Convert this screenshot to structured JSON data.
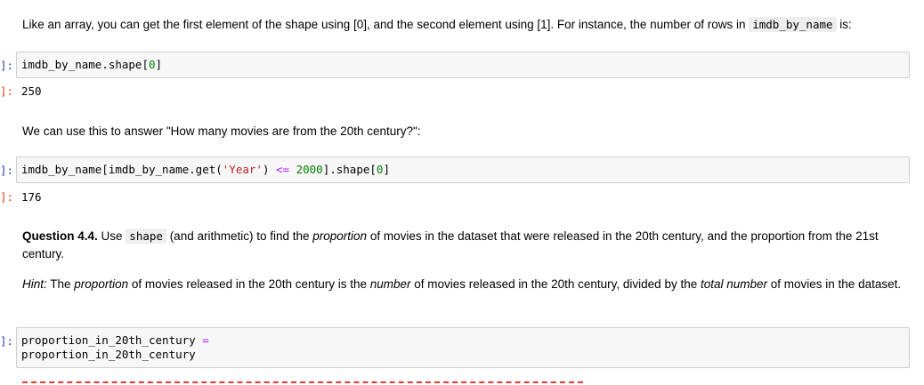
{
  "intro": {
    "text_a": "Like an array, you can get the first element of the shape using [0], and the second element using [1]. For instance, the number of rows in ",
    "code": "imdb_by_name",
    "text_b": " is:"
  },
  "cell1": {
    "prompt": "]:",
    "code_a": "imdb_by_name.shape[",
    "num": "0",
    "code_b": "]",
    "out_prompt": "]:",
    "output": "250"
  },
  "para2": "We can use this to answer \"How many movies are from the 20th century?\":",
  "cell2": {
    "prompt": "]:",
    "code_a": "imdb_by_name[imdb_by_name.get(",
    "str": "'Year'",
    "code_b": ") ",
    "op": "<=",
    "code_c": " ",
    "num1": "2000",
    "code_d": "].shape[",
    "num2": "0",
    "code_e": "]",
    "out_prompt": "]:",
    "output": "176"
  },
  "question": {
    "label": "Question 4.4.",
    "t1": " Use ",
    "code": "shape",
    "t2": " (and arithmetic) to find the ",
    "em1": "proportion",
    "t3": " of movies in the dataset that were released in the 20th century, and the proportion from the 21st century."
  },
  "hint": {
    "label": "Hint:",
    "t1": " The ",
    "em1": "proportion",
    "t2": " of movies released in the 20th century is the ",
    "em2": "number",
    "t3": " of movies released in the 20th century, divided by the ",
    "em3": "total number",
    "t4": " of movies in the dataset."
  },
  "cell3": {
    "prompt": "]:",
    "line1": "proportion_in_20th_century ",
    "op": "=",
    "line2": "proportion_in_20th_century"
  }
}
